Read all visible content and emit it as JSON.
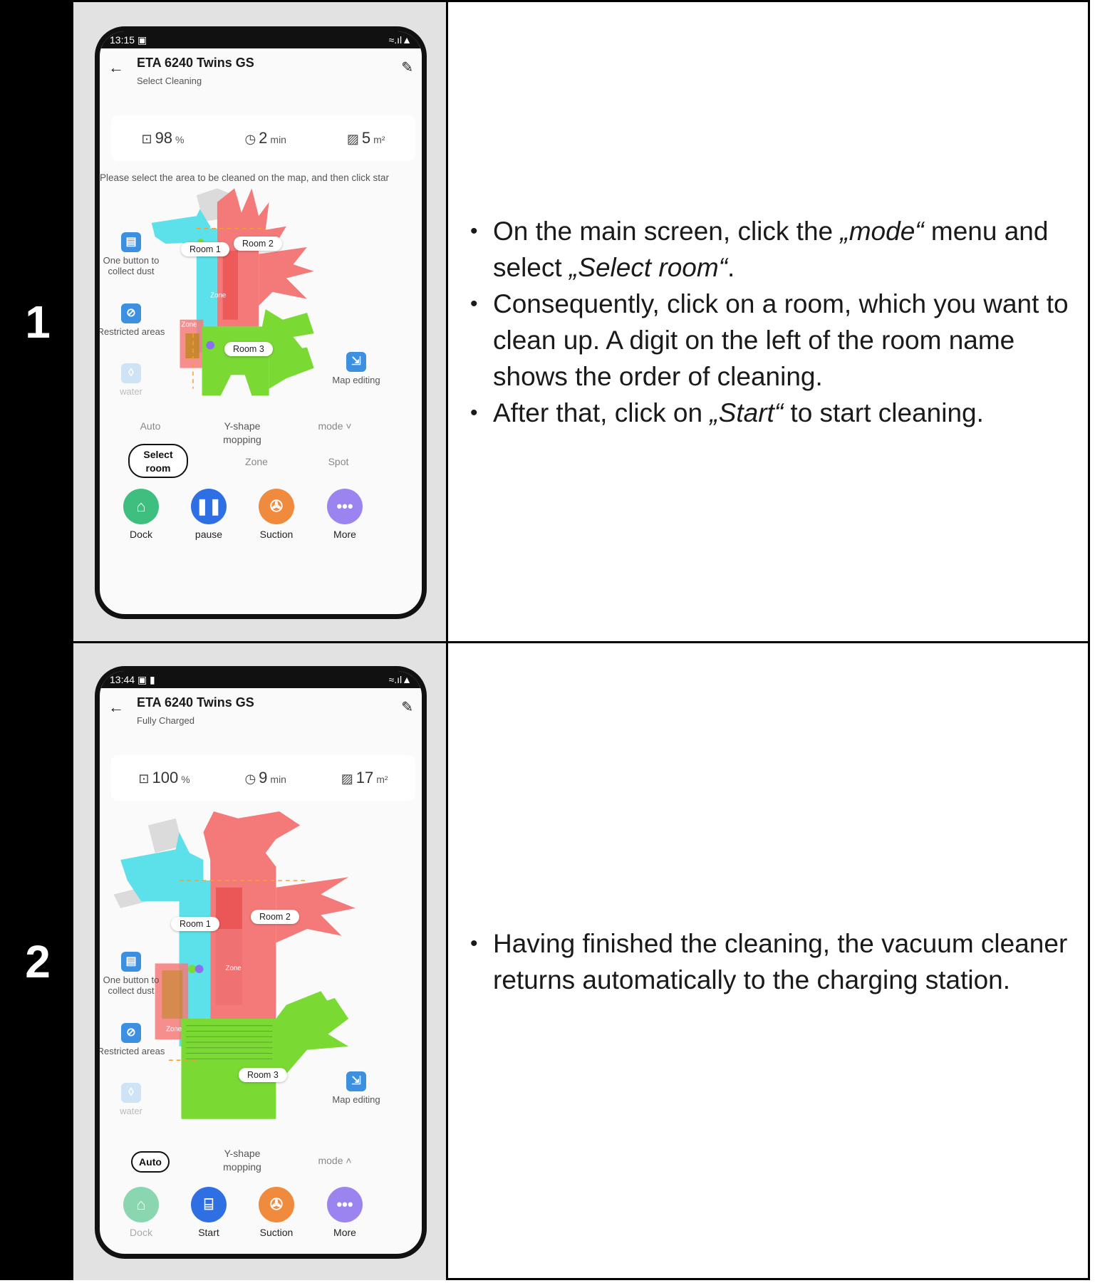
{
  "steps": [
    {
      "number": "1",
      "phone": {
        "status_time": "13:15",
        "status_left_icons": "▣",
        "status_right_icons": "≈.ıl▲",
        "title": "ETA 6240 Twins GS",
        "subtitle": "Select Cleaning",
        "stats": {
          "battery_value": "98",
          "battery_unit": "%",
          "time_value": "2",
          "time_unit": "min",
          "area_value": "5",
          "area_unit": "m²"
        },
        "hint": "Please select the area to be cleaned on the map, and then click star",
        "room_labels": [
          "Room 1",
          "Room 2",
          "Room 3"
        ],
        "zone_label": "Zone",
        "side_tools": {
          "collect": "One button to collect dust",
          "restricted": "Restricted areas",
          "water": "water",
          "map_edit": "Map editing"
        },
        "modes": {
          "auto": "Auto",
          "yshape": "Y-shape mopping",
          "mode": "mode ˅",
          "select_room": "Select room",
          "zone": "Zone",
          "spot": "Spot"
        },
        "actions": {
          "dock": "Dock",
          "primary": "pause",
          "suction": "Suction",
          "more": "More"
        }
      },
      "bullets": [
        {
          "pre": "On the main screen, click the ",
          "em": "„mode“",
          "post": " menu and select ",
          "em2": "„Select room“",
          "post2": "."
        },
        {
          "text": "Consequently, click on a room, which you want to clean up. A digit on the left of the room name shows the order of cleaning."
        },
        {
          "pre": "After that, click on ",
          "em": "„Start“",
          "post": " to start cleaning."
        }
      ]
    },
    {
      "number": "2",
      "phone": {
        "status_time": "13:44",
        "status_left_icons": "▣ ▮",
        "status_right_icons": "≈.ıl▲",
        "title": "ETA 6240 Twins GS",
        "subtitle": "Fully Charged",
        "stats": {
          "battery_value": "100",
          "battery_unit": "%",
          "time_value": "9",
          "time_unit": "min",
          "area_value": "17",
          "area_unit": "m²"
        },
        "room_labels": [
          "Room 1",
          "Room 2",
          "Room 3"
        ],
        "zone_label": "Zone",
        "side_tools": {
          "collect": "One button to collect dust",
          "restricted": "Restricted areas",
          "water": "water",
          "map_edit": "Map editing"
        },
        "modes": {
          "auto": "Auto",
          "yshape": "Y-shape mopping",
          "mode": "mode ˄"
        },
        "actions": {
          "dock": "Dock",
          "primary": "Start",
          "suction": "Suction",
          "more": "More"
        }
      },
      "bullets": [
        {
          "text": "Having finished the cleaning, the vacuum cleaner returns automatically to the charging station."
        }
      ]
    }
  ],
  "colors": {
    "room1": "#5ce1ea",
    "room2": "#f47a7a",
    "room3": "#7bd934",
    "dock_green": "#3fbf7f",
    "pause_blue": "#2f6fe4",
    "suction_orange": "#f08a3c",
    "more_purple": "#9b84f0"
  }
}
